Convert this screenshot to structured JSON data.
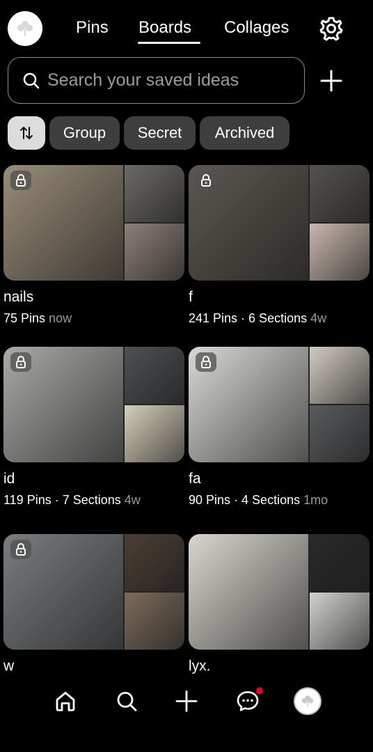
{
  "header": {
    "tabs": [
      {
        "label": "Pins"
      },
      {
        "label": "Boards",
        "active": true
      },
      {
        "label": "Collages"
      }
    ],
    "avatar_icon": "clover-icon",
    "settings_icon": "gear-icon"
  },
  "search": {
    "placeholder": "Search your saved ideas",
    "value": ""
  },
  "filters": {
    "sort_icon": "sort-arrows-icon",
    "chips": [
      "Group",
      "Secret",
      "Archived"
    ]
  },
  "boards": [
    {
      "name": "nails",
      "meta": "75 Pins",
      "time": "now",
      "private": true,
      "colors": {
        "main": "#9a8c78",
        "side_top": "#6b6a66",
        "side_bot": "#8d7f7a"
      }
    },
    {
      "name": "f",
      "meta": "241 Pins · 6 Sections",
      "time": "4w",
      "private": true,
      "colors": {
        "main": "#5c5750",
        "side_top": "#55534f",
        "side_bot": "#c9b6ad"
      }
    },
    {
      "name": "id",
      "meta": "119 Pins · 7 Sections",
      "time": "4w",
      "private": true,
      "colors": {
        "main": "#a9a9a6",
        "side_top": "#4e5053",
        "side_bot": "#d6cfba"
      }
    },
    {
      "name": "fa",
      "meta": "90 Pins · 4 Sections",
      "time": "1mo",
      "private": true,
      "colors": {
        "main": "#d8d8d4",
        "side_top": "#d1ccc2",
        "side_bot": "#595c5e"
      }
    },
    {
      "name": "w",
      "meta": "",
      "time": "",
      "private": true,
      "colors": {
        "main": "#797d80",
        "side_top": "#4c3e35",
        "side_bot": "#7d6b5b"
      }
    },
    {
      "name": "lyx.",
      "meta": "",
      "time": "",
      "private": false,
      "colors": {
        "main": "#d9d6cf",
        "side_top": "#2a2a2a",
        "side_bot": "#d2d2cf"
      }
    }
  ],
  "bottom_nav": [
    {
      "icon": "home-icon"
    },
    {
      "icon": "search-icon"
    },
    {
      "icon": "plus-icon"
    },
    {
      "icon": "messages-icon",
      "badge": true,
      "badge_color": "#e60023"
    },
    {
      "icon": "profile-icon"
    }
  ],
  "colors": {
    "background": "#000000",
    "chip": "#3e3e3e",
    "sort_chip": "#dcdcdc",
    "muted_text": "#9a9a9a"
  }
}
